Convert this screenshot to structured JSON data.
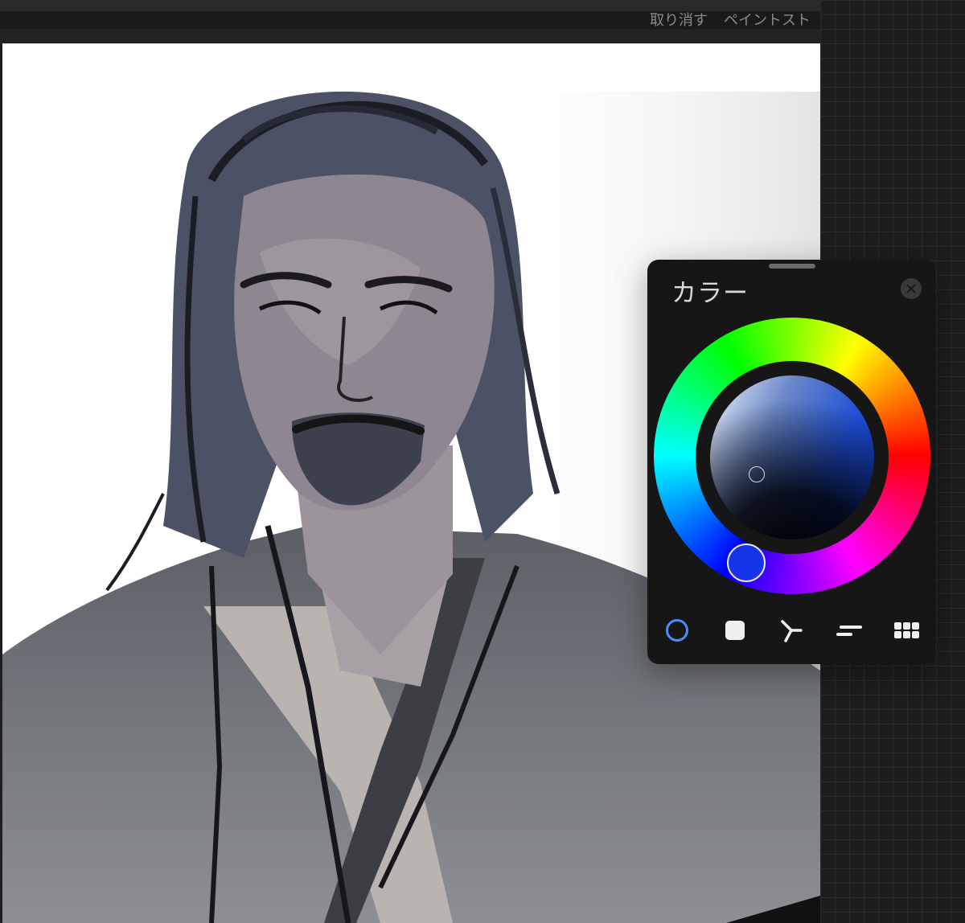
{
  "toolbar": {
    "undo_label": "取り消す",
    "stroke_label": "ペイントスト"
  },
  "color_panel": {
    "title": "カラー",
    "modes": [
      {
        "name": "disc",
        "icon": "circle-icon",
        "active": true
      },
      {
        "name": "classic",
        "icon": "square-icon",
        "active": false
      },
      {
        "name": "harmony",
        "icon": "harmony-icon",
        "active": false
      },
      {
        "name": "value",
        "icon": "sliders-icon",
        "active": false
      },
      {
        "name": "palettes",
        "icon": "grid-icon",
        "active": false
      }
    ],
    "colors": {
      "accent": "#4d8cf6",
      "current_hue": "#1735e8",
      "panel_bg": "#161617"
    }
  }
}
